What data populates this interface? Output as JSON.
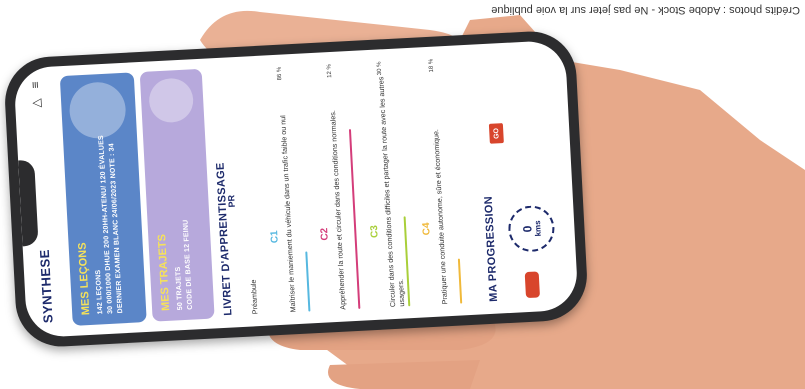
{
  "credit": "Crédits photos : Adobe Stock - Ne pas jeter sur la voie publique",
  "app": {
    "title": "SYNTHESE",
    "cards": [
      {
        "heading": "MES LEÇONS",
        "lines": [
          "142 LEÇONS",
          "30 000/1000 DHUE 200 20HH-ATENU/ 120 ÉVALUES",
          "DERNIER EXAMEN BLANC 24/06/2023 NOTE : 34"
        ]
      },
      {
        "heading": "MES TRAJETS",
        "lines": [
          "50 TRAJETS",
          "CODE DE BASE 12 FEINU"
        ]
      }
    ],
    "livret_title": "LIVRET D'APPRENTISSAGE",
    "pr_label": "PR",
    "preambule": "Préambule",
    "competences": [
      {
        "code": "C1",
        "text": "Maîtriser le maniement du véhicule dans un trafic faible ou nul",
        "pct": "86 %",
        "color": "#56b8e0"
      },
      {
        "code": "C2",
        "text": "Appréhender la route et circuler dans des conditions normales.",
        "pct": "12 %",
        "color": "#d43d7a"
      },
      {
        "code": "C3",
        "text": "Circuler dans des conditions difficiles et partager la route avec les autres usagers.",
        "pct": "30 %",
        "color": "#a9cf3a"
      },
      {
        "code": "C4",
        "text": "Pratiquer une conduite autonome, sûre et économique.",
        "pct": "18 %",
        "color": "#f0b93a"
      }
    ],
    "progression_title": "MA PROGRESSION",
    "go_label": "GO",
    "km_value": "0",
    "km_unit": "kms"
  }
}
